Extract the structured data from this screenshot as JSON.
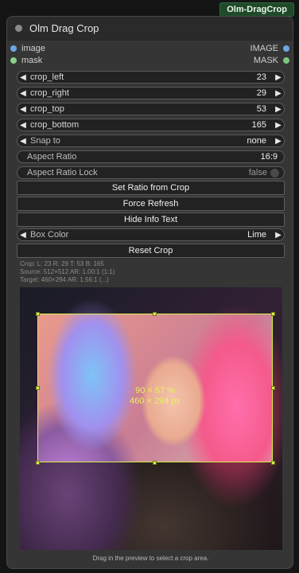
{
  "node": {
    "badge": "Olm-DragCrop",
    "title": "Olm Drag Crop"
  },
  "inputs": [
    {
      "label": "image",
      "color": "#6aa8e2"
    },
    {
      "label": "mask",
      "color": "#8bd08b"
    }
  ],
  "outputs": [
    {
      "label": "IMAGE",
      "color": "#6aa8e2"
    },
    {
      "label": "MASK",
      "color": "#8bd08b"
    }
  ],
  "widgets": {
    "crop_left": {
      "label": "crop_left",
      "value": "23"
    },
    "crop_right": {
      "label": "crop_right",
      "value": "29"
    },
    "crop_top": {
      "label": "crop_top",
      "value": "53"
    },
    "crop_bottom": {
      "label": "crop_bottom",
      "value": "165"
    },
    "snap_to": {
      "label": "Snap to",
      "value": "none"
    },
    "aspect_ratio": {
      "label": "Aspect Ratio",
      "value": "16:9"
    },
    "aspect_ratio_lock": {
      "label": "Aspect Ratio Lock",
      "value": "false"
    },
    "box_color": {
      "label": "Box Color",
      "value": "Lime"
    }
  },
  "buttons": {
    "set_ratio": "Set Ratio from Crop",
    "force_refresh": "Force Refresh",
    "hide_info": "Hide Info Text",
    "reset_crop": "Reset Crop"
  },
  "info": {
    "line1": "Crop: L: 23 R: 29 T: 53 B: 165",
    "line2": "Source: 512×512 AR: 1.00:1 (1:1)",
    "line3": "Target: 460×294 AR: 1.56:1 (...)"
  },
  "preview": {
    "percent_label": "90 × 57 %",
    "pixel_label": "460 × 294 px",
    "hint": "Drag in the preview to select a crop area."
  },
  "accent_color": "#d6ef4a"
}
